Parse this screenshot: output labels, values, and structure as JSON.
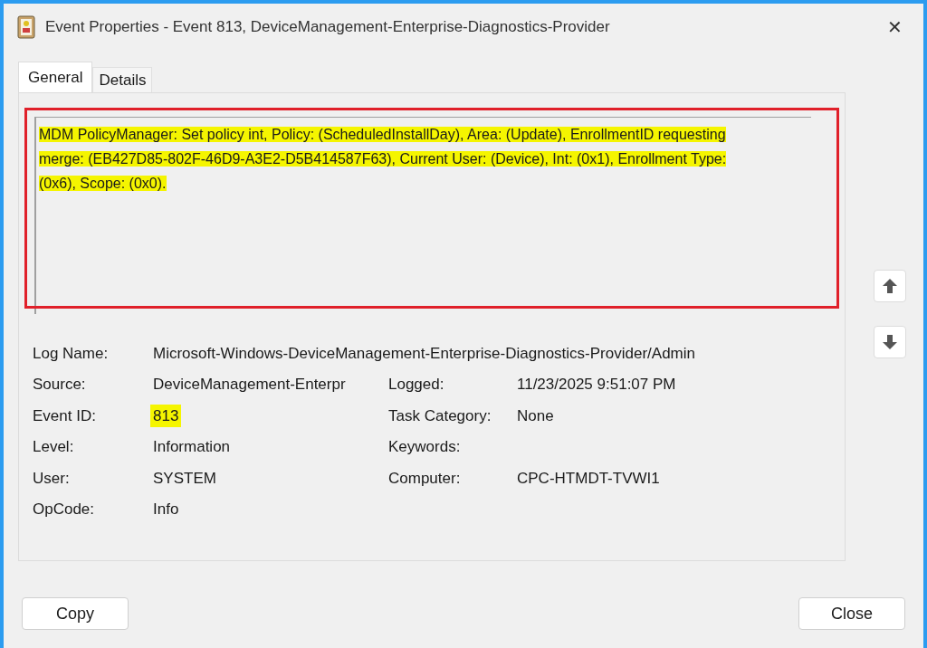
{
  "window": {
    "title": "Event Properties - Event 813, DeviceManagement-Enterprise-Diagnostics-Provider",
    "close": "✕"
  },
  "tabs": [
    {
      "label": "General",
      "selected": true
    },
    {
      "label": "Details",
      "selected": false
    }
  ],
  "description": {
    "text": "MDM PolicyManager: Set policy int, Policy: (ScheduledInstallDay), Area: (Update), EnrollmentID requesting merge: (EB427D85-802F-46D9-A3E2-D5B414587F63), Current User: (Device), Int: (0x1), Enrollment Type: (0x6), Scope: (0x0).",
    "highlighted": true,
    "outlined": true
  },
  "rows": [
    {
      "cells": [
        {
          "label": "Log Name:",
          "value": "Microsoft-Windows-DeviceManagement-Enterprise-Diagnostics-Provider/Admin"
        }
      ]
    },
    {
      "cells": [
        {
          "label": "Source:",
          "value": "DeviceManagement-Enterpr"
        },
        {
          "label": "Logged:",
          "value": "11/23/2025 9:51:07 PM"
        }
      ]
    },
    {
      "cells": [
        {
          "label": "Event ID:",
          "value": "813",
          "highlighted": true
        },
        {
          "label": "Task Category:",
          "value": "None"
        }
      ]
    },
    {
      "cells": [
        {
          "label": "Level:",
          "value": "Information"
        },
        {
          "label": "Keywords:"
        }
      ]
    },
    {
      "cells": [
        {
          "label": "User:",
          "value": "SYSTEM"
        },
        {
          "label": "Computer:",
          "value": "CPC-HTMDT-TVWI1"
        }
      ]
    },
    {
      "cells": [
        {
          "label": "OpCode:",
          "value": "Info"
        }
      ]
    }
  ],
  "buttons": [
    "Copy",
    "Close"
  ]
}
